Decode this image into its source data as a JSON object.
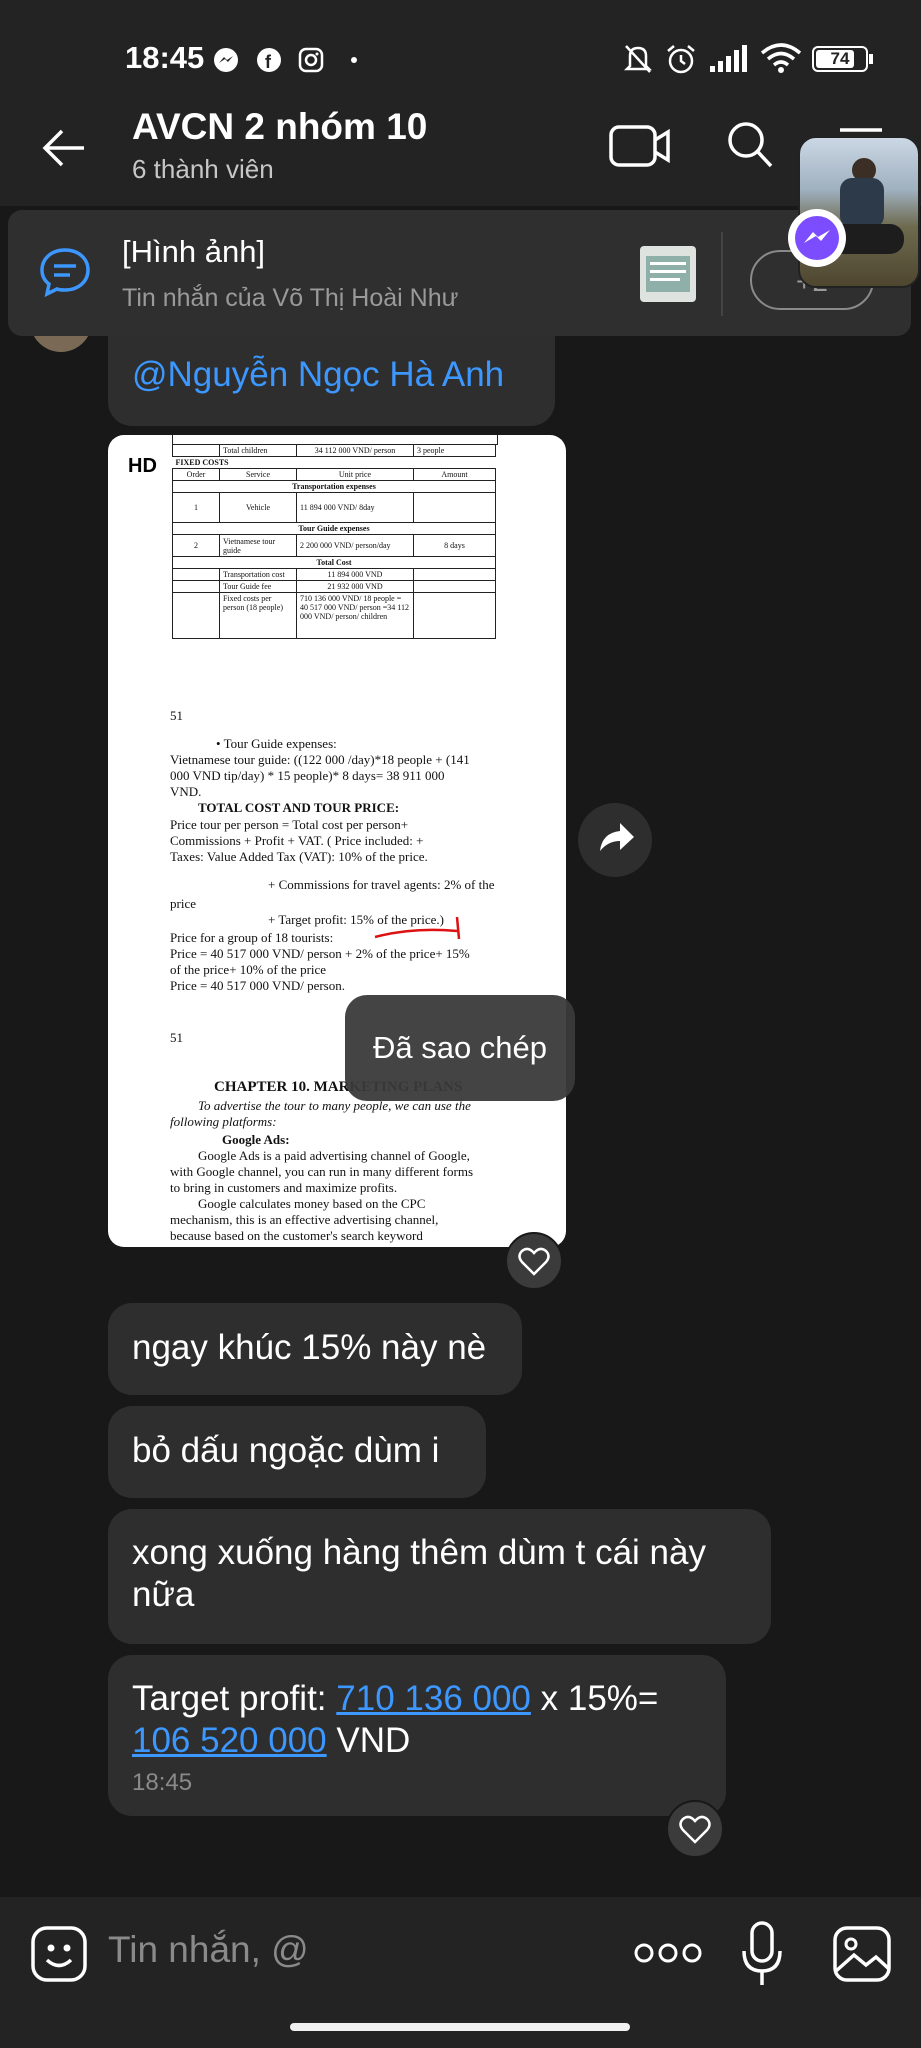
{
  "status_bar": {
    "time": "18:45",
    "battery": "74"
  },
  "header": {
    "title": "AVCN 2 nhóm 10",
    "subtitle": "6 thành viên"
  },
  "pinned": {
    "title": "[Hình ảnh]",
    "subtitle": "Tin nhắn của Võ Thị Hoài Như",
    "more": "+2"
  },
  "messages": {
    "mention": "@Nguyễn Ngọc Hà Anh",
    "m1": "ngay khúc 15% này nè",
    "m2": "bỏ dấu ngoặc dùm i",
    "m3": "xong xuống hàng thêm dùm t cái này nữa",
    "m4_prefix": "Target profit: ",
    "m4_link1": "710 136 000",
    "m4_mid": " x 15%=",
    "m4_link2": "106 520 000",
    "m4_suffix": " VND",
    "m4_time": "18:45"
  },
  "image_doc": {
    "badge": "HD",
    "row_total_children": [
      "Total children",
      "34 112 000 VND/ person",
      "3 people"
    ],
    "fixed_costs": "FIXED COSTS",
    "cols": [
      "Order",
      "Service",
      "Unit price",
      "Amount"
    ],
    "transport_section": "Transportation expenses",
    "row_vehicle": [
      "1",
      "Vehicle",
      "11 894 000 VND/ 8day",
      ""
    ],
    "guide_section": "Tour Guide expenses",
    "row_guide": [
      "2",
      "Vietnamese tour guide",
      "2 200 000 VND/ person/day",
      "8 days"
    ],
    "total_section": "Total Cost",
    "row_tc1": [
      "Transportation cost",
      "11 894 000 VND"
    ],
    "row_tc2": [
      "Tour Guide fee",
      "21 932 000 VND"
    ],
    "row_tc3": [
      "Fixed costs per person (18 people)",
      "710 136 000 VND/ 18 people = 40 517 000 VND/ person =34 112 000 VND/ person/ children"
    ],
    "page_num": "51",
    "lines": [
      "• Tour Guide expenses:",
      "Vietnamese tour guide: ((122 000 /day)*18 people + (141",
      "000 VND tip/day) * 15 people)* 8 days= 38 911 000",
      "VND.",
      "TOTAL COST AND TOUR PRICE:",
      "Price tour per person = Total cost per person+",
      "Commissions + Profit + VAT. ( Price included: +",
      "Taxes: Value Added Tax (VAT): 10% of the price.",
      "+ Commissions for travel agents: 2% of the",
      "price",
      "+ Target profit: 15% of the price.)",
      "Price for a group of 18 tourists:",
      "Price = 40 517 000 VND/ person + 2% of the price+ 15%",
      "of the price+ 10% of the price",
      "Price = 40 517 000 VND/ person."
    ],
    "page_num2": "51",
    "chapter": "CHAPTER 10. MARKETING PLANS",
    "chapter_lines": [
      "To advertise the tour to many people, we can use the",
      "following platforms:",
      "Google Ads:",
      "Google Ads is a paid advertising channel of Google,",
      "with Google channel, you can run in many different forms",
      "to bring in customers and maximize profits.",
      "Google calculates money based on the CPC",
      "mechanism, this is an effective advertising channel,",
      "because based on the customer's search keyword"
    ]
  },
  "toast": "Đã sao chép",
  "composer": {
    "placeholder": "Tin nhắn, @"
  }
}
